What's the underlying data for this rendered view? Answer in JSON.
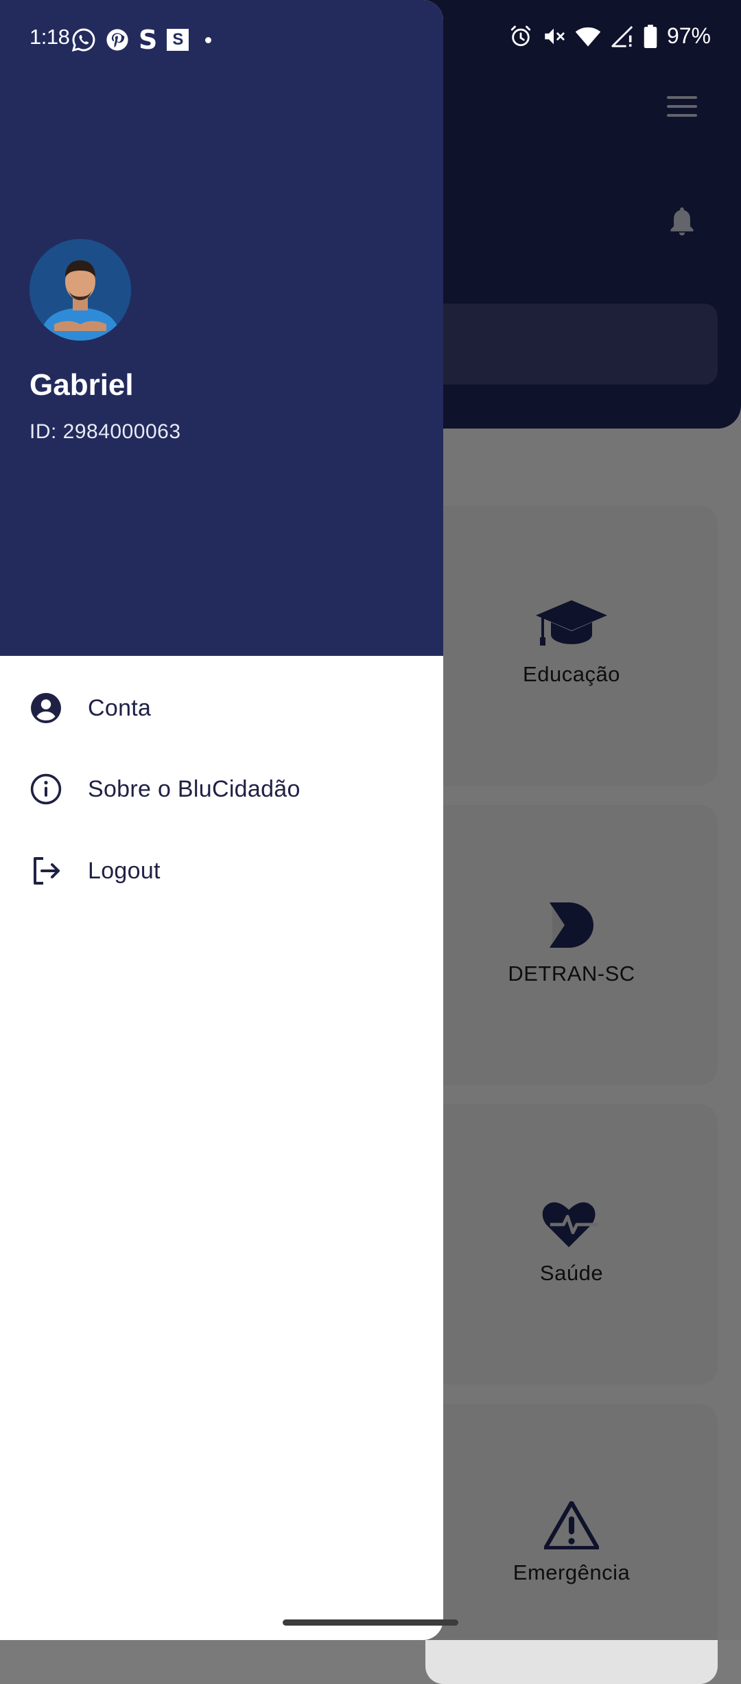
{
  "status_bar": {
    "time": "1:18",
    "left_icons": [
      "whatsapp-icon",
      "pinterest-icon",
      "s-app-icon",
      "s-box-app-icon",
      "dot-icon"
    ],
    "right_icons": [
      "alarm-icon",
      "vibrate-off-icon",
      "wifi-icon",
      "signal-icon",
      "battery-icon"
    ],
    "battery": "97%"
  },
  "drawer": {
    "user": {
      "name": "Gabriel",
      "id_text": "ID: 2984000063"
    },
    "items": [
      {
        "label": "Conta",
        "icon": "account-circle-icon"
      },
      {
        "label": "Sobre o BluCidadão",
        "icon": "info-icon"
      },
      {
        "label": "Logout",
        "icon": "logout-icon"
      }
    ]
  },
  "background": {
    "cards": [
      {
        "label": "Educação",
        "icon": "graduation-cap-icon"
      },
      {
        "label": "DETRAN-SC",
        "icon": "detran-logo-icon"
      },
      {
        "label": "Saúde",
        "icon": "heart-pulse-icon"
      },
      {
        "label": "Emergência",
        "icon": "warning-icon"
      }
    ]
  },
  "colors": {
    "drawer_header": "#232b5d",
    "app_header": "#1f2557",
    "accent_navy": "#1f2144"
  }
}
